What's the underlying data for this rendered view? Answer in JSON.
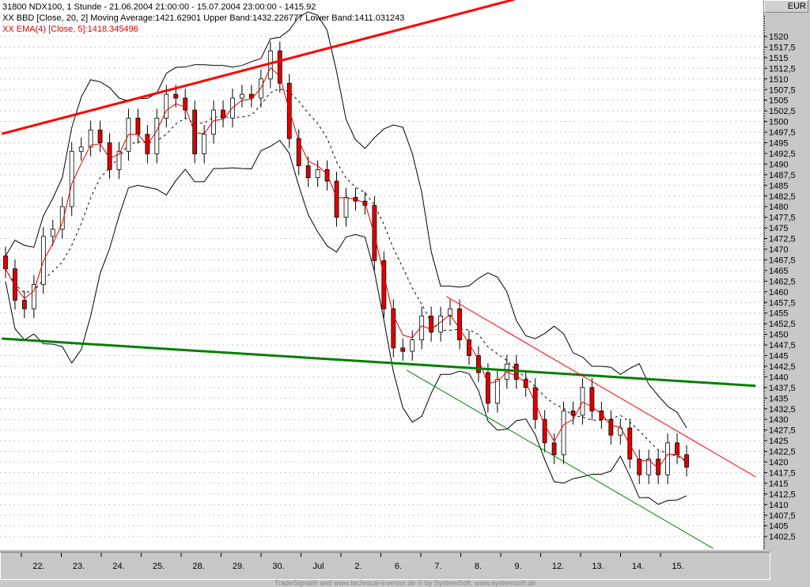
{
  "header": {
    "line1": "31800  NDX100, 1 Stunde - 21.06.2004 21:00:00 - 15.07.2004 23:00:00 - 1415.92",
    "line2": "XX BBD [Close, 20, 2] Moving Average:1421.62901 Upper Band:1432.226777 Lower Band:1411.031243",
    "line3": "XX EMA(4) [Close, 5]:1418.345496"
  },
  "axis": {
    "currency": "EUR"
  },
  "footer": "TradeSignal® and www.technical-investor.de © by SystemSoft, www.systemsoft.de",
  "colors": {
    "up": "#ffffff",
    "down": "#e00000",
    "ema": "#e00000",
    "band": "#000000",
    "trend_red": "#ff0000",
    "trend_green": "#008000"
  },
  "chart_data": {
    "type": "candlestick",
    "title": "31800 NDX100, 1 Stunde",
    "ylabel": "EUR",
    "ylim": [
      1400,
      1528.7
    ],
    "yticks": [
      "1520",
      "1517,5",
      "1515",
      "1512,5",
      "1510",
      "1507,5",
      "1505",
      "1502,5",
      "1500",
      "1497,5",
      "1495",
      "1492,5",
      "1490",
      "1487,5",
      "1485",
      "1482,5",
      "1480",
      "1477,5",
      "1475",
      "1472,5",
      "1470",
      "1467,5",
      "1465",
      "1462,5",
      "1460",
      "1457,5",
      "1455",
      "1452,5",
      "1450",
      "1447,5",
      "1445",
      "1442,5",
      "1440",
      "1437,5",
      "1435",
      "1432,5",
      "1430",
      "1427,5",
      "1425",
      "1422,5",
      "1420",
      "1417,5",
      "1415",
      "1412,5",
      "1410",
      "1407,5",
      "1405",
      "1402,5"
    ],
    "xticks": [
      "22.",
      "23.",
      "24.",
      "25.",
      "28.",
      "29.",
      "30.",
      "Jul",
      "2.",
      "6.",
      "7.",
      "8.",
      "9.",
      "12.",
      "13.",
      "14.",
      "15."
    ],
    "closes": [
      1465.4,
      1458,
      1456,
      1461.7,
      1473,
      1474.7,
      1480,
      1493,
      1494,
      1498,
      1495,
      1488.7,
      1493,
      1500.8,
      1497,
      1492.4,
      1500.8,
      1506.4,
      1505.5,
      1502.7,
      1492.4,
      1497,
      1502.7,
      1500.8,
      1505.5,
      1506.4,
      1505.5,
      1510,
      1516.6,
      1509,
      1496,
      1489.6,
      1486.8,
      1488.7,
      1486,
      1477.5,
      1482.2,
      1481.3,
      1480.3,
      1467.3,
      1456,
      1446.8,
      1446,
      1448.7,
      1454.3,
      1450.5,
      1454.3,
      1456,
      1448.7,
      1445,
      1441,
      1433.8,
      1439.4,
      1443,
      1439.4,
      1437.5,
      1430,
      1424.5,
      1421.7,
      1432,
      1431,
      1437.5,
      1432,
      1430,
      1426.3,
      1428,
      1420.7,
      1417,
      1420.7,
      1417,
      1424.5,
      1421.7,
      1418.8
    ],
    "trendlines": [
      {
        "name": "upper-resistance",
        "color": "red",
        "width": 3,
        "from": [
          -0.4,
          1497.1
        ],
        "to": [
          53.8,
          1528.7
        ]
      },
      {
        "name": "support",
        "color": "green",
        "width": 3,
        "from": [
          -0.4,
          1449
        ],
        "to": [
          79.3,
          1437.9
        ]
      },
      {
        "name": "channel-top",
        "color": "red",
        "width": 1,
        "from": [
          46.6,
          1458.9
        ],
        "to": [
          79.3,
          1416.5
        ]
      },
      {
        "name": "channel-bottom",
        "color": "green",
        "width": 1,
        "from": [
          42.4,
          1441.6
        ],
        "to": [
          74.8,
          1399.7
        ]
      }
    ]
  }
}
